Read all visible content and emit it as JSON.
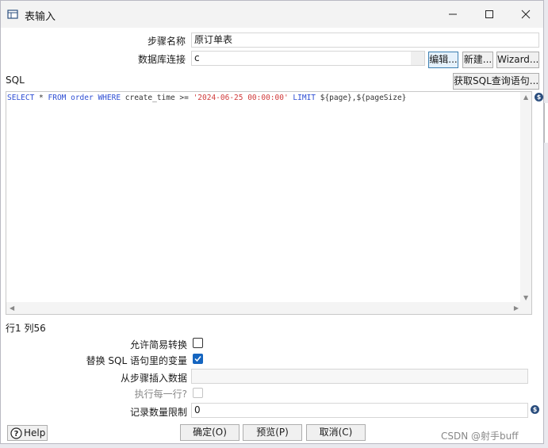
{
  "window": {
    "title": "表输入"
  },
  "form": {
    "step_name_label": "步骤名称",
    "step_name_value": "原订单表",
    "db_conn_label": "数据库连接",
    "db_conn_value": "c",
    "edit_button": "编辑...",
    "new_button": "新建...",
    "wizard_button": "Wizard...",
    "sql_label": "SQL",
    "get_sql_button": "获取SQL查询语句...",
    "sql_keyword_select": "SELECT",
    "sql_star": " * ",
    "sql_keyword_from": "FROM",
    "sql_table": " order ",
    "sql_keyword_where": "WHERE",
    "sql_cond": " create_time >= ",
    "sql_date": "'2024-06-25 00:00:00'",
    "sql_space": " ",
    "sql_keyword_limit": "LIMIT",
    "sql_tail": " ${page},${pageSize}",
    "cursor_position": "行1 列56",
    "lazy_conversion_label": "允许简易转换",
    "lazy_conversion_checked": false,
    "replace_vars_label": "替换 SQL 语句里的变量",
    "replace_vars_checked": true,
    "insert_from_step_label": "从步骤插入数据",
    "insert_from_step_value": "",
    "execute_each_row_label": "执行每一行?",
    "execute_each_row_checked": false,
    "limit_label": "记录数量限制",
    "limit_value": "0"
  },
  "footer": {
    "help_button": "Help",
    "ok_button": "确定(O)",
    "preview_button": "预览(P)",
    "cancel_button": "取消(C)"
  },
  "watermark": "CSDN @射手buff",
  "colors": {
    "keyword": "#2f4fd4",
    "string": "#d13b3b",
    "checkbox_checked": "#1565c0",
    "variable_icon": "#2b4e7e"
  }
}
